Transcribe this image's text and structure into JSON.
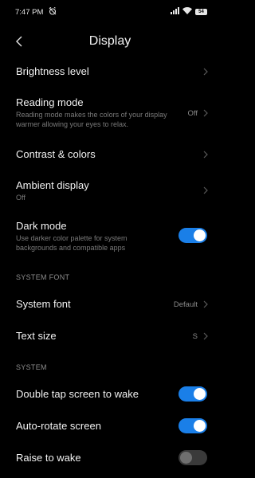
{
  "status_bar": {
    "time": "7:47 PM",
    "battery": "54"
  },
  "header": {
    "title": "Display"
  },
  "settings": {
    "brightness": {
      "title": "Brightness level"
    },
    "reading_mode": {
      "title": "Reading mode",
      "subtitle": "Reading mode makes the colors of your display warmer allowing your eyes to relax.",
      "value": "Off"
    },
    "contrast": {
      "title": "Contrast & colors"
    },
    "ambient": {
      "title": "Ambient display",
      "subtitle": "Off"
    },
    "dark_mode": {
      "title": "Dark mode",
      "subtitle": "Use darker color palette for system backgrounds and compatible apps",
      "enabled": true
    }
  },
  "sections": {
    "system_font": "SYSTEM FONT",
    "system": "SYSTEM"
  },
  "font": {
    "system_font": {
      "title": "System font",
      "value": "Default"
    },
    "text_size": {
      "title": "Text size",
      "value": "S"
    }
  },
  "system": {
    "double_tap": {
      "title": "Double tap screen to wake",
      "enabled": true
    },
    "auto_rotate": {
      "title": "Auto-rotate screen",
      "enabled": true
    },
    "raise_to_wake": {
      "title": "Raise to wake",
      "enabled": false
    }
  },
  "colors": {
    "accent": "#1a7fe8",
    "background": "#000000",
    "toggle_off": "#3a3a3a"
  }
}
